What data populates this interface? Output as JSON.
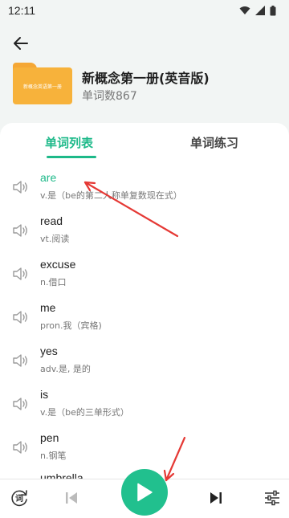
{
  "status_bar": {
    "time": "12:11"
  },
  "book": {
    "cover_text": "新概念英语第一册",
    "title": "新概念第一册(英音版)",
    "word_count": "单词数867"
  },
  "tabs": {
    "words": "单词列表",
    "practice": "单词练习"
  },
  "words": [
    {
      "word": "are",
      "meaning": "v.是（be的第二人称单复数现在式）"
    },
    {
      "word": "read",
      "meaning": "vt.阅读"
    },
    {
      "word": "excuse",
      "meaning": "n.借口"
    },
    {
      "word": "me",
      "meaning": "pron.我（宾格)"
    },
    {
      "word": "yes",
      "meaning": "adv.是, 是的"
    },
    {
      "word": "is",
      "meaning": "v.是（be的三单形式）"
    },
    {
      "word": "pen",
      "meaning": "n.钢笔"
    },
    {
      "word": "umbrella",
      "meaning": ""
    }
  ],
  "bottom_bar": {
    "loop_label": "词"
  },
  "colors": {
    "accent": "#1db989",
    "annotation": "#e53935"
  }
}
